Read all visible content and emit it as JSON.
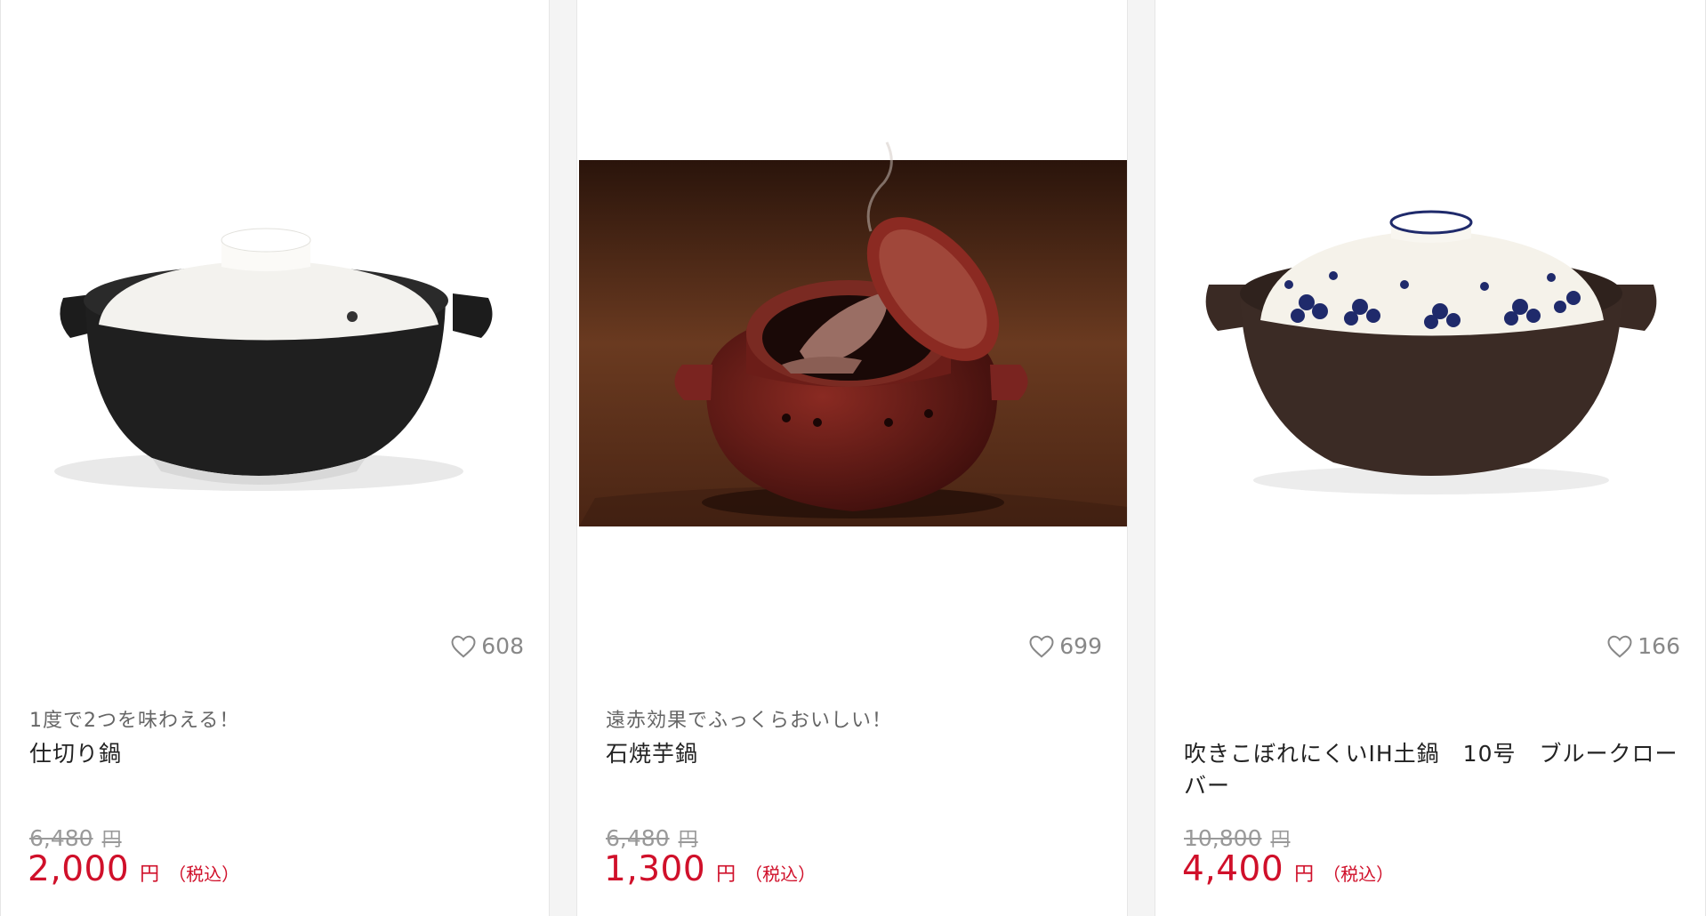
{
  "products": [
    {
      "image_alt": "black and white donabe clay pot",
      "likes": "608",
      "catch": "1度で2つを味わえる！",
      "name": "仕切り鍋",
      "original_price": "6,480",
      "original_unit": "円",
      "price": "2,000",
      "price_unit": "円",
      "tax": "（税込）"
    },
    {
      "image_alt": "red stone baked sweet potato pot",
      "likes": "699",
      "catch": "遠赤効果でふっくらおいしい！",
      "name": "石焼芋鍋",
      "original_price": "6,480",
      "original_unit": "円",
      "price": "1,300",
      "price_unit": "円",
      "tax": "（税込）"
    },
    {
      "image_alt": "brown donabe with blue clover lid",
      "likes": "166",
      "catch": "",
      "name": "吹きこぼれにくいIH土鍋　10号　ブルークローバー",
      "original_price": "10,800",
      "original_unit": "円",
      "price": "4,400",
      "price_unit": "円",
      "tax": "（税込）"
    }
  ],
  "icons": {
    "like": "heart-outline-icon"
  },
  "colors": {
    "sale_price": "#d0102a",
    "muted": "#888888"
  }
}
